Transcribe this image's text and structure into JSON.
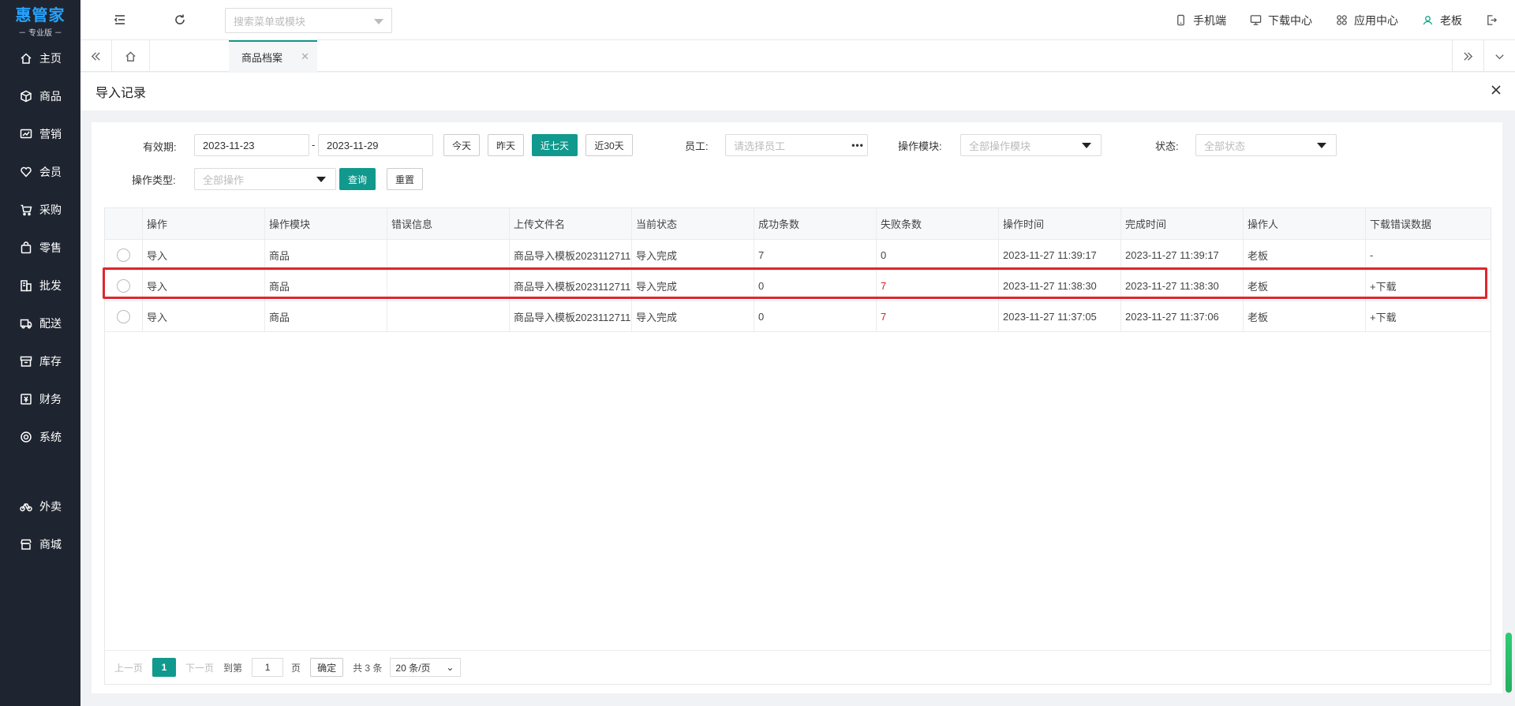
{
  "brand": {
    "name": "惠管家",
    "edition": "－ 专业版 －"
  },
  "sidebar": {
    "items": [
      {
        "label": "主页",
        "icon": "home-icon"
      },
      {
        "label": "商品",
        "icon": "box-icon"
      },
      {
        "label": "营销",
        "icon": "chart-icon"
      },
      {
        "label": "会员",
        "icon": "heart-icon"
      },
      {
        "label": "采购",
        "icon": "cart-icon"
      },
      {
        "label": "零售",
        "icon": "bag-icon"
      },
      {
        "label": "批发",
        "icon": "building-icon"
      },
      {
        "label": "配送",
        "icon": "truck-icon"
      },
      {
        "label": "库存",
        "icon": "archive-icon"
      },
      {
        "label": "财务",
        "icon": "money-icon"
      },
      {
        "label": "系统",
        "icon": "gear-icon"
      }
    ],
    "extra_items": [
      {
        "label": "外卖",
        "icon": "bike-icon"
      },
      {
        "label": "商城",
        "icon": "shop-icon"
      }
    ]
  },
  "header": {
    "search_placeholder": "搜索菜单或模块",
    "links": {
      "mobile": "手机端",
      "download": "下载中心",
      "apps": "应用中心",
      "user": "老板"
    }
  },
  "tabs": {
    "active": "商品档案"
  },
  "panel": {
    "title": "导入记录"
  },
  "filters": {
    "validity_label": "有效期:",
    "date_start": "2023-11-23",
    "date_sep": "-",
    "date_end": "2023-11-29",
    "quick": {
      "today": "今天",
      "yesterday": "昨天",
      "seven": "近七天",
      "thirty": "近30天"
    },
    "employee_label": "员工:",
    "employee_placeholder": "请选择员工",
    "module_label": "操作模块:",
    "module_value": "全部操作模块",
    "status_label": "状态:",
    "status_value": "全部状态",
    "optype_label": "操作类型:",
    "optype_value": "全部操作",
    "query": "查询",
    "reset": "重置"
  },
  "table": {
    "columns": [
      "操作",
      "操作模块",
      "错误信息",
      "上传文件名",
      "当前状态",
      "成功条数",
      "失败条数",
      "操作时间",
      "完成时间",
      "操作人",
      "下载错误数据"
    ],
    "rows": [
      {
        "op": "导入",
        "module": "商品",
        "error": "",
        "file": "商品导入模板2023112711...",
        "status": "导入完成",
        "success": "7",
        "fail": "0",
        "op_time": "2023-11-27 11:39:17",
        "done_time": "2023-11-27 11:39:17",
        "operator": "老板",
        "download": "-"
      },
      {
        "op": "导入",
        "module": "商品",
        "error": "",
        "file": "商品导入模板2023112711...",
        "status": "导入完成",
        "success": "0",
        "fail": "7",
        "op_time": "2023-11-27 11:38:30",
        "done_time": "2023-11-27 11:38:30",
        "operator": "老板",
        "download": "+下载"
      },
      {
        "op": "导入",
        "module": "商品",
        "error": "",
        "file": "商品导入模板2023112711...",
        "status": "导入完成",
        "success": "0",
        "fail": "7",
        "op_time": "2023-11-27 11:37:05",
        "done_time": "2023-11-27 11:37:06",
        "operator": "老板",
        "download": "+下载"
      }
    ]
  },
  "pager": {
    "prev": "上一页",
    "current": "1",
    "next": "下一页",
    "goto": "到第",
    "page_input": "1",
    "page_unit": "页",
    "confirm": "确定",
    "total": "共 3 条",
    "page_size": "20 条/页"
  },
  "colors": {
    "accent": "#11998e",
    "sidebar": "#1f2530",
    "highlight": "#e0262d",
    "fail_red": "#e02020"
  }
}
